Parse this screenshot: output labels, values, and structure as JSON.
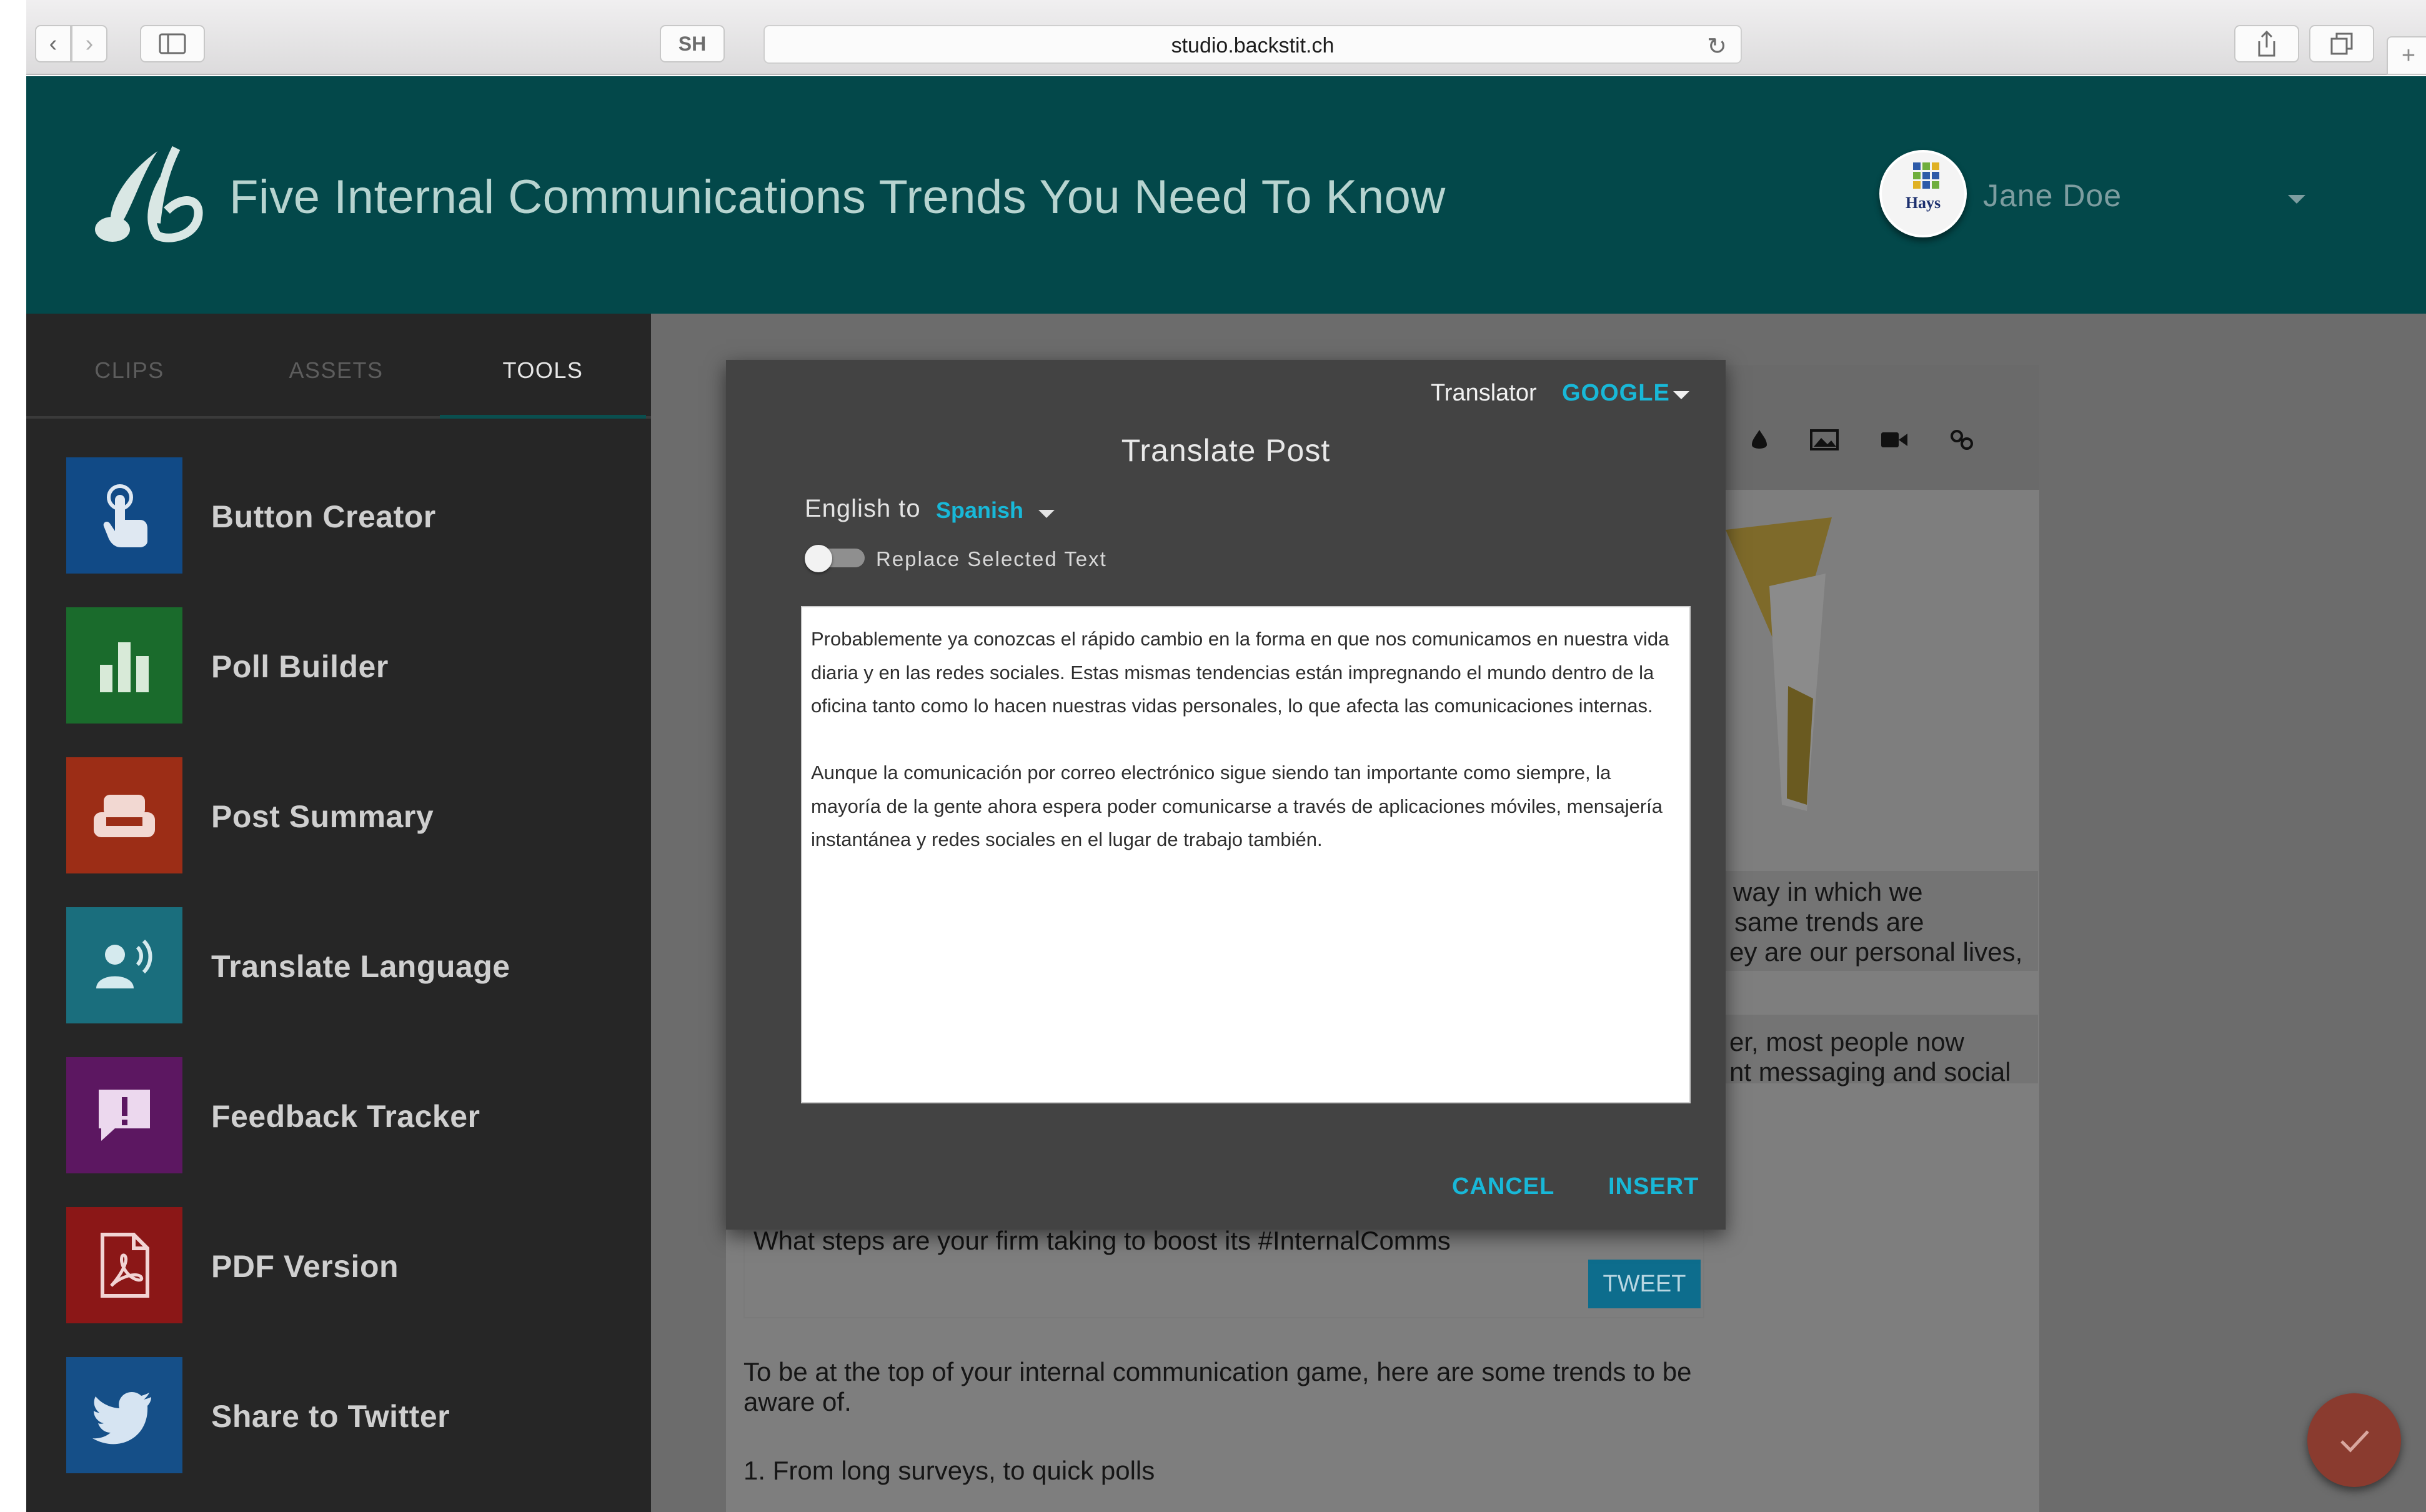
{
  "browser": {
    "url": "studio.backstit.ch",
    "tab_badge": "SH",
    "icons": [
      "back-icon",
      "forward-icon",
      "sidebar-toggle-icon",
      "reload-icon",
      "share-icon",
      "tabs-icon",
      "new-tab-icon"
    ]
  },
  "header": {
    "title": "Five Internal Communications Trends You Need To Know",
    "avatar_text": "Hays",
    "user_name": "Jane Doe",
    "colors": {
      "background": "#03484a",
      "title": "#b7d4d0"
    }
  },
  "sidebar": {
    "tabs": [
      {
        "label": "CLIPS",
        "active": false
      },
      {
        "label": "ASSETS",
        "active": false
      },
      {
        "label": "TOOLS",
        "active": true
      }
    ],
    "tools": [
      {
        "label": "Button Creator",
        "icon": "pointer-hand-icon",
        "color": "#114a86"
      },
      {
        "label": "Poll Builder",
        "icon": "bar-chart-icon",
        "color": "#1a6b2c"
      },
      {
        "label": "Post Summary",
        "icon": "couch-icon",
        "color": "#9c2d16"
      },
      {
        "label": "Translate Language",
        "icon": "speaker-person-icon",
        "color": "#1a6e7d"
      },
      {
        "label": "Feedback Tracker",
        "icon": "feedback-icon",
        "color": "#5c1761"
      },
      {
        "label": "PDF Version",
        "icon": "pdf-icon",
        "color": "#8b1717"
      },
      {
        "label": "Share to Twitter",
        "icon": "twitter-icon",
        "color": "#154f88"
      }
    ]
  },
  "editor": {
    "toolbar_icons": [
      "drop-icon",
      "image-icon",
      "video-icon",
      "link-icon"
    ],
    "background_lines": [
      "way in which we",
      "same trends are",
      "ey are our personal lives,",
      "er, most people now",
      "nt messaging and social"
    ],
    "tweet_text": "What steps are your firm taking to boost its #InternalComms",
    "tweet_button": "TWEET",
    "body_lines": [
      "To be at the top of your internal communication game, here are some trends to be",
      "aware of.",
      "1. From long surveys, to quick polls"
    ]
  },
  "modal": {
    "translator_label": "Translator",
    "translator_value": "GOOGLE",
    "title": "Translate Post",
    "from_language": "English to",
    "to_language": "Spanish",
    "toggle_label": "Replace Selected Text",
    "toggle_on": false,
    "paragraphs": [
      "Probablemente ya conozcas el rápido cambio en la forma en que nos comunicamos en nuestra vida diaria y en las redes sociales. Estas mismas tendencias están impregnando el mundo dentro de la oficina tanto como lo hacen nuestras vidas personales, lo que afecta las comunicaciones internas.",
      "Aunque la comunicación por correo electrónico sigue siendo tan importante como siempre, la mayoría de la gente ahora espera poder comunicarse a través de aplicaciones móviles, mensajería instantánea y redes sociales en el lugar de trabajo también."
    ],
    "cancel_label": "CANCEL",
    "insert_label": "INSERT",
    "accent_color": "#18b8d8"
  },
  "fab": {
    "icon": "checkmark-icon",
    "color": "#8a3b2f"
  }
}
